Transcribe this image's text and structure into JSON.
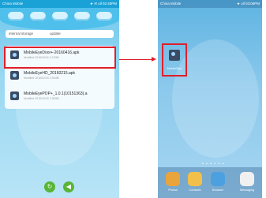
{
  "left_phone": {
    "carrier": "China Mobile",
    "status_right": "★ ✉ ull 02:40PM",
    "path": {
      "crumb1": "internal storage",
      "crumb2": "update"
    },
    "files": [
      {
        "name": "MobileEyeDoor+-20160416.apk",
        "meta": "Modified 2016/04/16  2.47MB"
      },
      {
        "name": "MobileEyeHD_20160215.apk",
        "meta": "Modified 2016/02/15  2.51MB"
      },
      {
        "name": "MobileEyePOP+_1.0.1(10151363).a",
        "meta": "Modified 2015/10/15  2.30MB"
      }
    ],
    "buttons": {
      "confirm_icon": "↻",
      "back_icon": "◀"
    }
  },
  "right_phone": {
    "carrier": "China Mobile",
    "status_right": "★ ull 03:06PM",
    "installed_app_label": "MobileEye",
    "page_dots": "• • • • • •",
    "dock": [
      {
        "label": "Photos",
        "color": "#e9a43b"
      },
      {
        "label": "Contacts",
        "color": "#f2c04a"
      },
      {
        "label": "Browser",
        "color": "#4ca0e0"
      },
      {
        "label": "Messaging",
        "color": "#f0f0f0"
      }
    ]
  },
  "colors": {
    "highlight": "#e01f2a",
    "statusbar": "#1aa1d6"
  }
}
